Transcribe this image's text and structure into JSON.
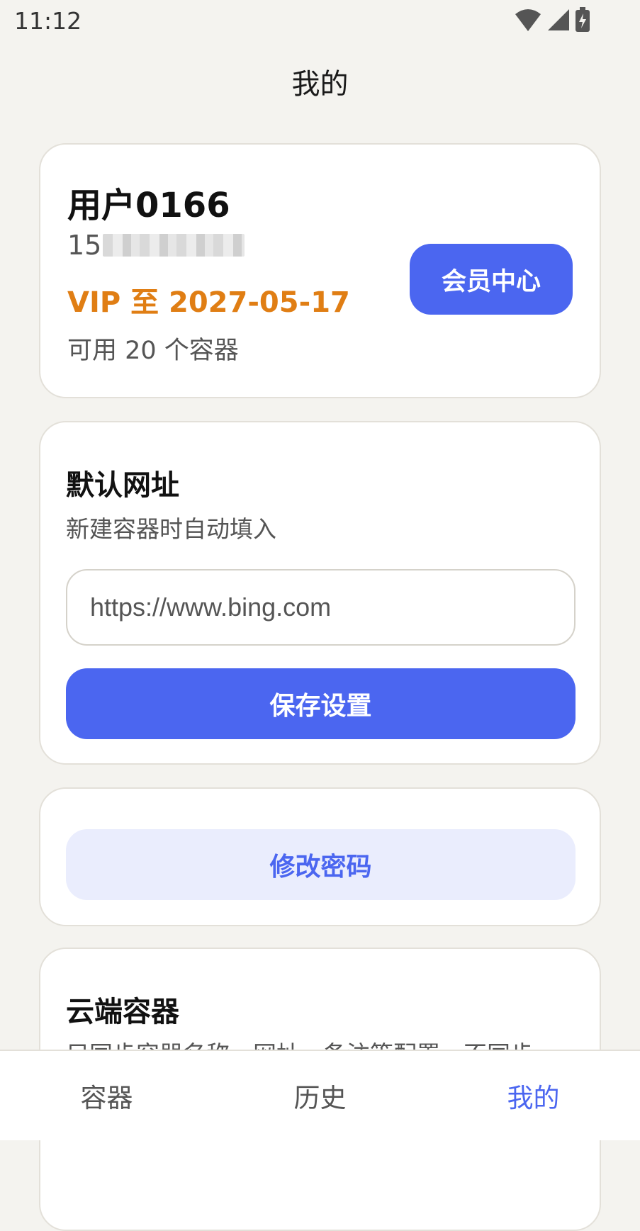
{
  "status_bar": {
    "time": "11:12"
  },
  "page": {
    "title": "我的"
  },
  "user_card": {
    "name": "用户0166",
    "phone_prefix": "15",
    "vip": "VIP 至 2027-05-17",
    "quota": "可用 20 个容器",
    "vip_button": "会员中心"
  },
  "default_url_card": {
    "title": "默认网址",
    "subtitle": "新建容器时自动填入",
    "url_value": "https://www.bing.com",
    "save_button": "保存设置"
  },
  "password_card": {
    "button": "修改密码"
  },
  "cloud_card": {
    "title": "云端容器",
    "subtitle": "只同步容器名称、网址、备注等配置，不同步"
  },
  "colors": {
    "accent": "#4B66F0",
    "vip": "#E07E14",
    "background": "#F4F3EF"
  },
  "bottom_nav": {
    "items": [
      {
        "label": "容器"
      },
      {
        "label": "历史"
      },
      {
        "label": "我的"
      }
    ],
    "active_index": 2
  }
}
